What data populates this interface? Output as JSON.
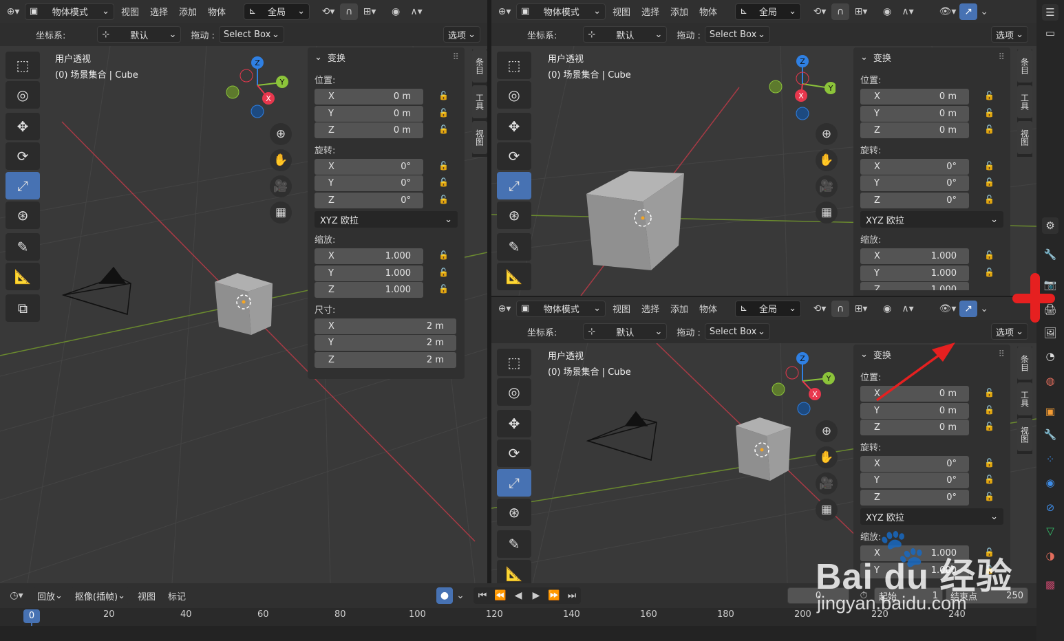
{
  "header": {
    "mode": "物体模式",
    "menus": [
      "视图",
      "选择",
      "添加",
      "物体"
    ],
    "transform_orientation": "全局"
  },
  "toolbar2": {
    "coord_label": "坐标系:",
    "coord_value": "默认",
    "drag_label": "拖动 :",
    "drag_value": "Select Box",
    "options": "选项"
  },
  "viewport": {
    "view_name": "用户透视",
    "collection": "(0) 场景集合 | Cube"
  },
  "gizmo": {
    "x": "X",
    "y": "Y",
    "z": "Z"
  },
  "panel": {
    "title": "变换",
    "location_label": "位置:",
    "location": [
      {
        "axis": "X",
        "value": "0 m"
      },
      {
        "axis": "Y",
        "value": "0 m"
      },
      {
        "axis": "Z",
        "value": "0 m"
      }
    ],
    "rotation_label": "旋转:",
    "rotation": [
      {
        "axis": "X",
        "value": "0°"
      },
      {
        "axis": "Y",
        "value": "0°"
      },
      {
        "axis": "Z",
        "value": "0°"
      }
    ],
    "rotation_mode": "XYZ 欧拉",
    "scale_label": "缩放:",
    "scale": [
      {
        "axis": "X",
        "value": "1.000"
      },
      {
        "axis": "Y",
        "value": "1.000"
      },
      {
        "axis": "Z",
        "value": "1.000"
      }
    ],
    "dimensions_label": "尺寸:",
    "dimensions": [
      {
        "axis": "X",
        "value": "2 m"
      },
      {
        "axis": "Y",
        "value": "2 m"
      },
      {
        "axis": "Z",
        "value": "2 m"
      }
    ]
  },
  "side_tabs": [
    "条目",
    "工具",
    "视图"
  ],
  "timeline": {
    "playback": "回放",
    "keying": "抠像(插帧)",
    "view": "视图",
    "marker": "标记",
    "current_frame": "0",
    "start_label": "起始",
    "start_value": "1",
    "end_label": "结束点",
    "end_value": "250",
    "frame_indicator": "0",
    "ticks": [
      "20",
      "40",
      "60",
      "80",
      "100",
      "120",
      "140",
      "160",
      "180",
      "200",
      "220",
      "240"
    ]
  },
  "watermark": {
    "brand": "Bai du 经验",
    "url": "jingyan.baidu.com"
  },
  "colors": {
    "accent": "#4772b3",
    "x_axis": "#e8374d",
    "y_axis": "#8cc43a",
    "z_axis": "#2f80e3",
    "arrow": "#e62020"
  }
}
